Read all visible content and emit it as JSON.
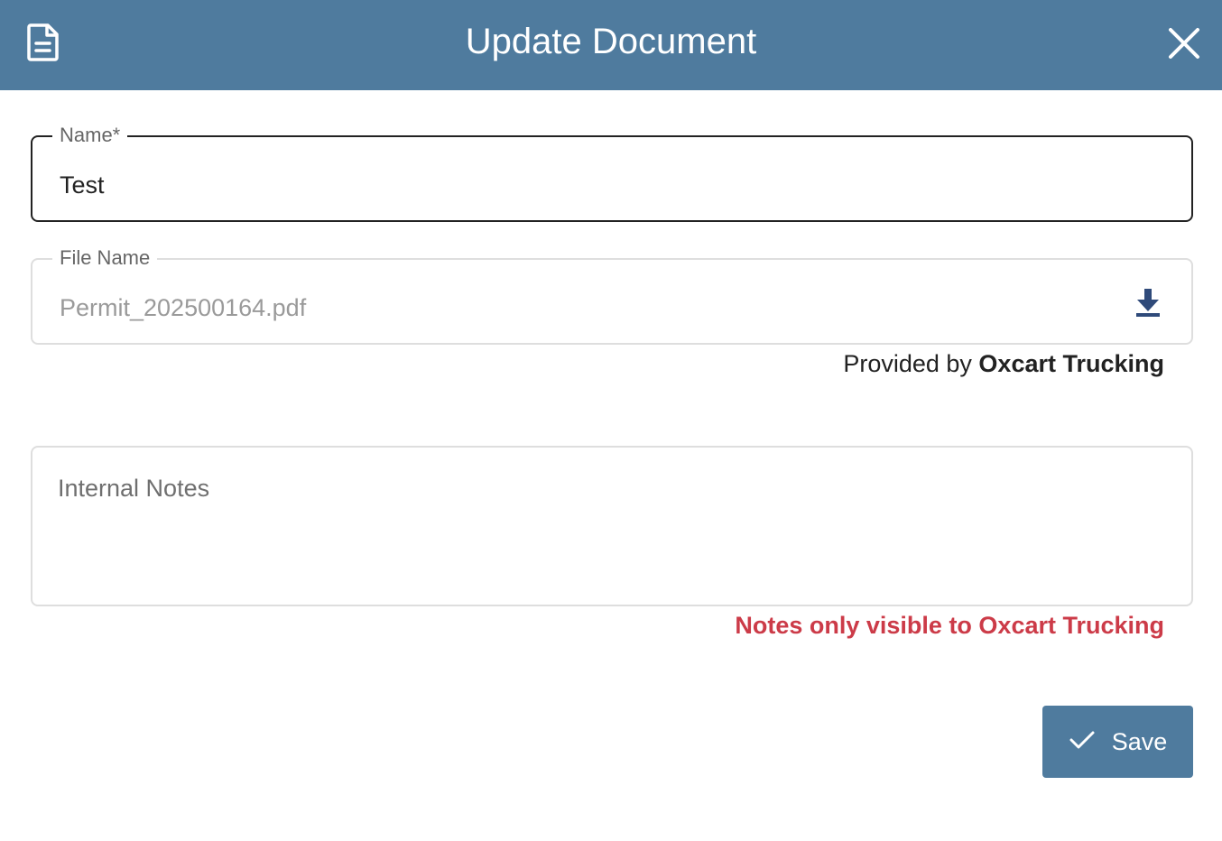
{
  "dialog": {
    "title": "Update Document",
    "header_icon": "document-icon",
    "close_icon": "close-icon",
    "header_color": "#4f7b9e"
  },
  "form": {
    "name": {
      "label": "Name*",
      "value": "Test"
    },
    "file_name": {
      "label": "File Name",
      "value": "Permit_202500164.pdf",
      "action_icon": "download-icon"
    },
    "provided_by": {
      "prefix": "Provided by",
      "company": "Oxcart Trucking"
    },
    "internal_notes": {
      "placeholder": "Internal Notes",
      "value": ""
    },
    "notes_visibility": "Notes only visible to Oxcart Trucking",
    "notes_visibility_color": "#cc3b48"
  },
  "actions": {
    "save_label": "Save",
    "save_icon": "check-icon"
  }
}
